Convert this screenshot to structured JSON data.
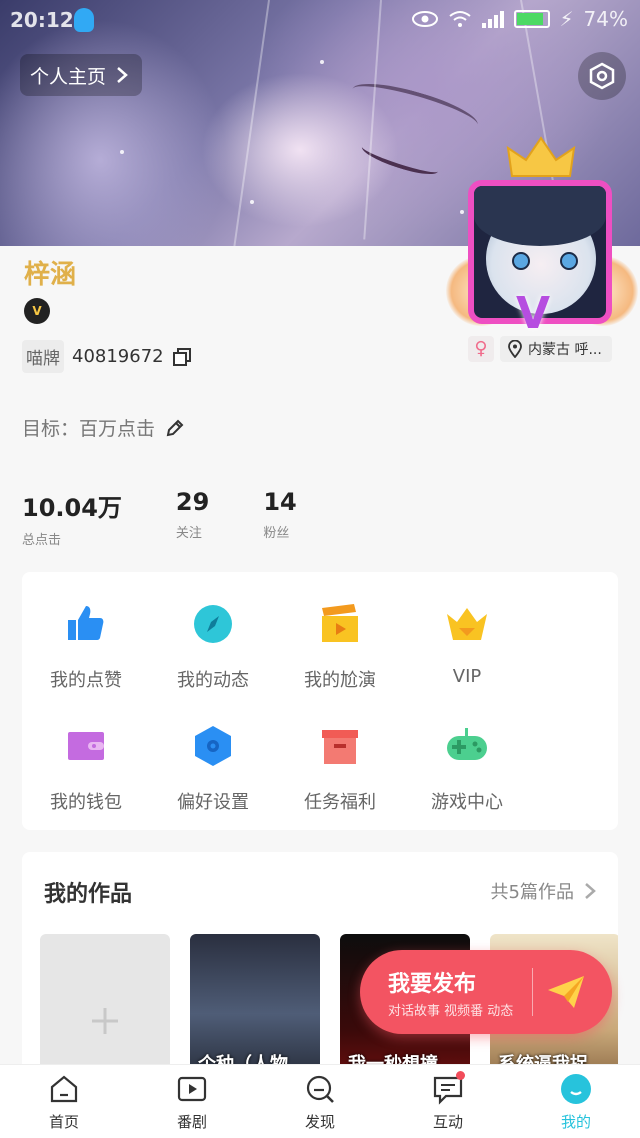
{
  "status_bar": {
    "time": "20:12",
    "battery": "74%"
  },
  "header": {
    "home_link": "个人主页"
  },
  "profile": {
    "nickname": "梓涵",
    "vip_badge_text": "V",
    "id_label": "喵牌",
    "id_value": "40819672",
    "gender_symbol": "♀",
    "location": "内蒙古 呼...",
    "goal_label": "目标：",
    "goal_value": "百万点击"
  },
  "stats": [
    {
      "value": "10.04万",
      "label": "总点击"
    },
    {
      "value": "29",
      "label": "关注"
    },
    {
      "value": "14",
      "label": "粉丝"
    }
  ],
  "menu": [
    {
      "label": "我的点赞",
      "icon": "thumbs-up-icon",
      "color": "#2a8ff3"
    },
    {
      "label": "我的动态",
      "icon": "compass-icon",
      "color": "#2ec6d8"
    },
    {
      "label": "我的尬演",
      "icon": "clapperboard-icon",
      "color": "#f9c322"
    },
    {
      "label": "VIP",
      "icon": "crown-icon",
      "color": "#f9c322"
    },
    {
      "label": "我的钱包",
      "icon": "wallet-icon",
      "color": "#c46be0"
    },
    {
      "label": "偏好设置",
      "icon": "hexagon-settings-icon",
      "color": "#2a8ff3"
    },
    {
      "label": "任务福利",
      "icon": "gift-box-icon",
      "color": "#f15b55"
    },
    {
      "label": "游戏中心",
      "icon": "gamepad-icon",
      "color": "#4ccf8f"
    }
  ],
  "works": {
    "title": "我的作品",
    "count_text": "共5篇作品",
    "items": [
      {
        "caption": ""
      },
      {
        "caption": "个种（人物"
      },
      {
        "caption": "我一秒想撞"
      },
      {
        "caption": "系统逼我捉"
      }
    ]
  },
  "publish": {
    "title": "我要发布",
    "subtitle": "对话故事  视频番  动态"
  },
  "tabs": [
    {
      "label": "首页",
      "icon": "home-icon"
    },
    {
      "label": "番剧",
      "icon": "play-box-icon"
    },
    {
      "label": "发现",
      "icon": "discover-search-icon"
    },
    {
      "label": "互动",
      "icon": "message-icon"
    },
    {
      "label": "我的",
      "icon": "profile-icon"
    }
  ],
  "colors": {
    "accent": "#27c3dc",
    "publish": "#f35462",
    "nickname": "#e0b04a"
  }
}
